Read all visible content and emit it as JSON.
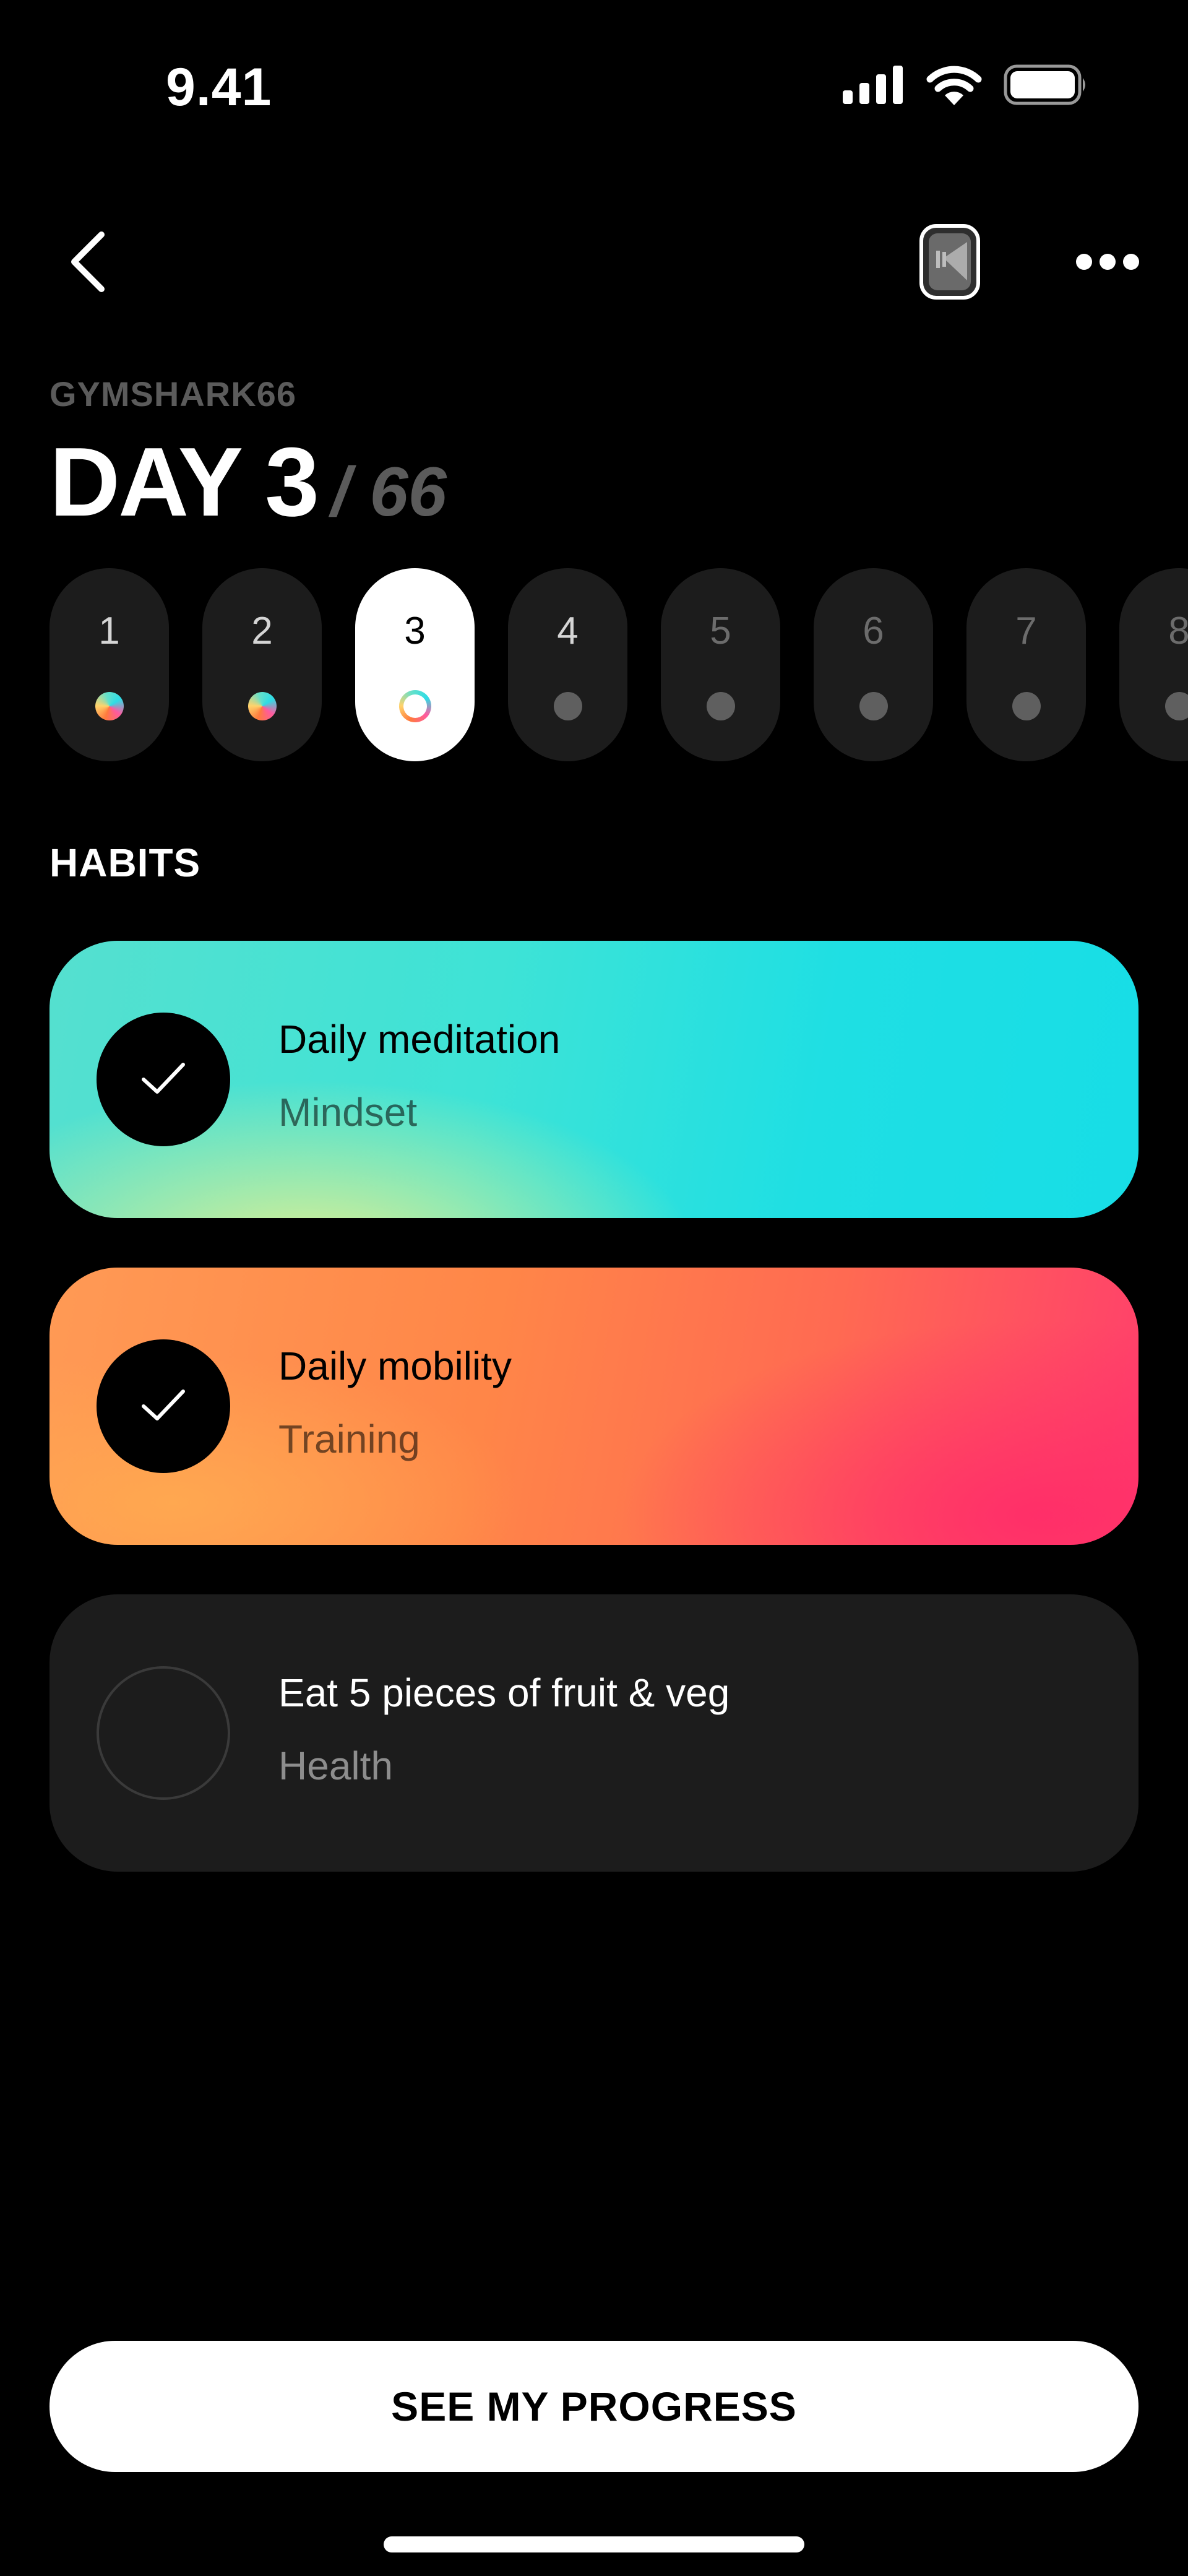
{
  "status_bar": {
    "time": "9.41",
    "icons": [
      "cellular-signal-icon",
      "wifi-icon",
      "battery-icon"
    ]
  },
  "header": {
    "back_icon": "chevron-left-icon",
    "watch_icon": "watch-icon",
    "more_icon": "more-horizontal-icon"
  },
  "challenge": {
    "name": "GYMSHARK66",
    "day_label": "DAY 3",
    "day_total": "/ 66",
    "current_day": 3,
    "total_days": 66
  },
  "days": [
    {
      "num": "1",
      "state": "complete"
    },
    {
      "num": "2",
      "state": "complete"
    },
    {
      "num": "3",
      "state": "active"
    },
    {
      "num": "4",
      "state": "pending"
    },
    {
      "num": "5",
      "state": "future"
    },
    {
      "num": "6",
      "state": "future"
    },
    {
      "num": "7",
      "state": "future"
    },
    {
      "num": "8",
      "state": "future"
    }
  ],
  "habits_section": {
    "title": "HABITS",
    "items": [
      {
        "name": "Daily meditation",
        "category": "Mindset",
        "checked": true
      },
      {
        "name": "Daily mobility",
        "category": "Training",
        "checked": true
      },
      {
        "name": "Eat 5 pieces of fruit & veg",
        "category": "Health",
        "checked": false
      }
    ]
  },
  "footer": {
    "progress_button": "SEE MY PROGRESS"
  },
  "colors": {
    "background": "#000000",
    "card_dark": "#1c1c1c",
    "muted_text": "#5b5b5b",
    "mindset_gradient": [
      "#e6ee8c",
      "#17dde6"
    ],
    "training_gradient": [
      "#ffa25a",
      "#ff3e6c"
    ]
  }
}
